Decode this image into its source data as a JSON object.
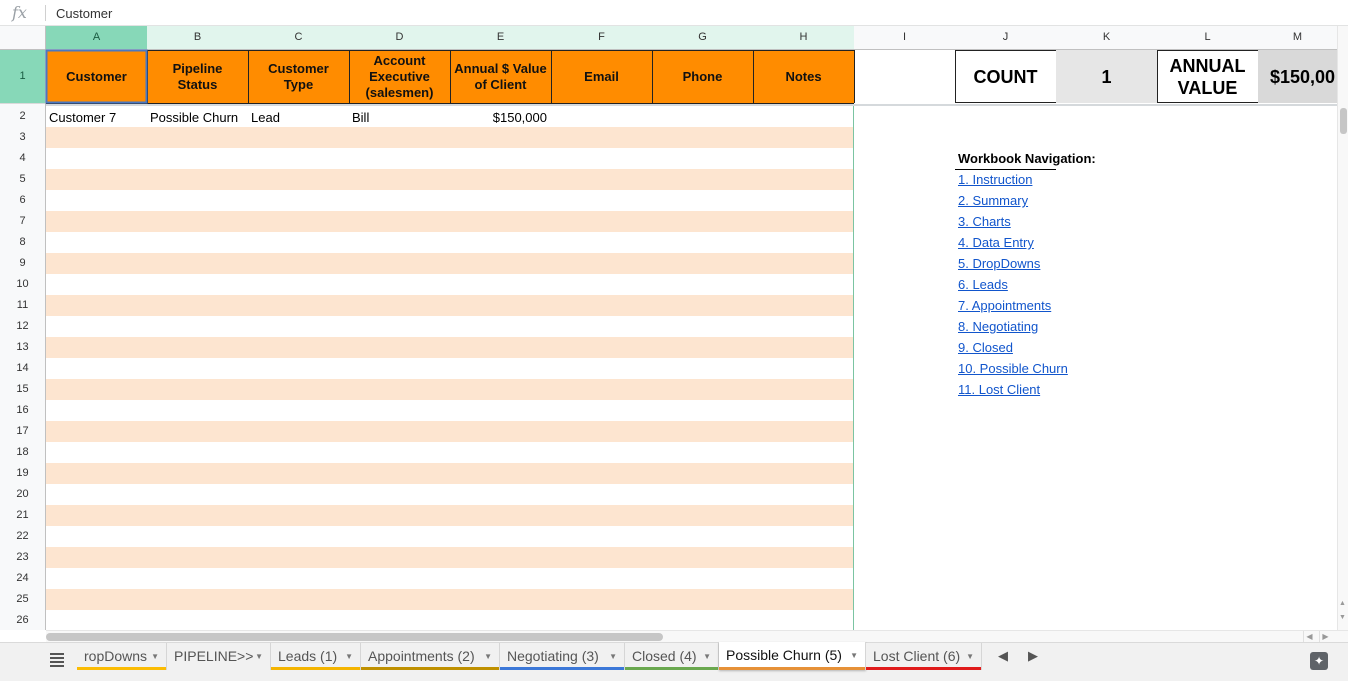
{
  "formula_bar": {
    "fx_label": "fx",
    "value": "Customer"
  },
  "columns": [
    "A",
    "B",
    "C",
    "D",
    "E",
    "F",
    "G",
    "H",
    "I",
    "J",
    "K",
    "L",
    "M"
  ],
  "rows": [
    "1",
    "2",
    "3",
    "4",
    "5",
    "6",
    "7",
    "8",
    "9",
    "10",
    "11",
    "12",
    "13",
    "14",
    "15",
    "16",
    "17",
    "18",
    "19",
    "20",
    "21",
    "22",
    "23",
    "24",
    "25",
    "26"
  ],
  "table": {
    "headers": [
      "Customer",
      "Pipeline Status",
      "Customer Type",
      "Account Executive (salesmen)",
      "Annual $ Value of Client",
      "Email",
      "Phone",
      "Notes"
    ],
    "rows": [
      [
        "Customer 7",
        "Possible Churn",
        "Lead",
        "Bill",
        "$150,000",
        "",
        "",
        ""
      ]
    ]
  },
  "summary": {
    "count_label": "COUNT",
    "count_value": "1",
    "annual_label": "ANNUAL VALUE",
    "annual_value": "$150,00"
  },
  "navigation": {
    "title": "Workbook Navigation:",
    "links": [
      "1. Instruction",
      "2. Summary",
      "3. Charts",
      "4. Data Entry",
      "5. DropDowns",
      "6. Leads",
      "7. Appointments",
      "8. Negotiating",
      "9. Closed",
      "10. Possible Churn",
      "11. Lost Client"
    ]
  },
  "tabs": [
    {
      "label": "ropDowns",
      "underline": "#fbbc04",
      "active": false
    },
    {
      "label": "PIPELINE>>",
      "underline": "",
      "active": false
    },
    {
      "label": "Leads (1)",
      "underline": "#f4b400",
      "active": false
    },
    {
      "label": "Appointments (2)",
      "underline": "#bf9000",
      "active": false
    },
    {
      "label": "Negotiating (3)",
      "underline": "#3c78d8",
      "active": false
    },
    {
      "label": "Closed (4)",
      "underline": "#6aa84f",
      "active": false
    },
    {
      "label": "Possible Churn (5)",
      "underline": "#e69138",
      "active": true
    },
    {
      "label": "Lost Client (6)",
      "underline": "#e01b1b",
      "active": false
    }
  ],
  "icons": {
    "all_sheets": "hamburger-menu-icon",
    "dropdown": "triangle-down-icon",
    "scroll_left": "chevron-left-icon",
    "scroll_right": "chevron-right-icon",
    "explore": "explore-icon"
  },
  "colors": {
    "header_orange": "#ff8c00",
    "band_peach": "#fde5d0",
    "selected_col_header": "#87d8b8",
    "col_header_bg": "#e1f5ed",
    "summary_gray": "#e6e6e6",
    "link_blue": "#1155cc"
  }
}
